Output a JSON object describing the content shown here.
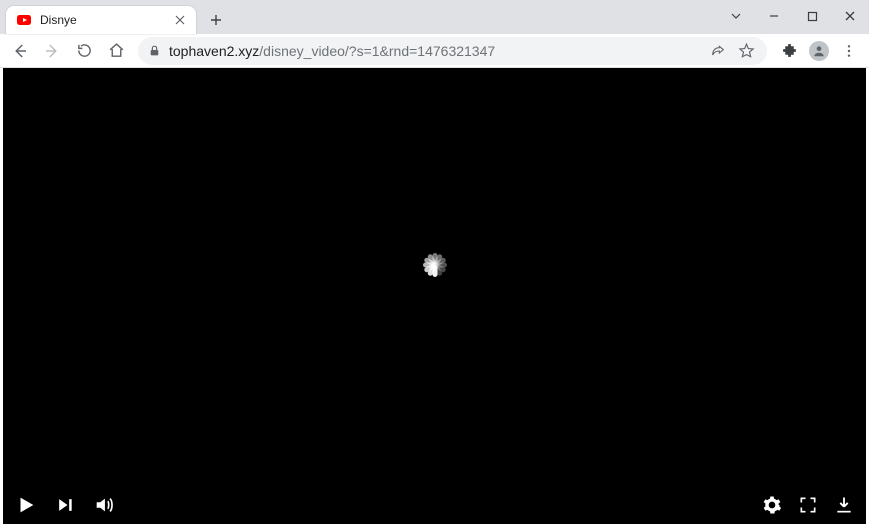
{
  "window": {
    "controls": {
      "minimize": "minimize",
      "maximize": "maximize",
      "close": "close",
      "dropdown": "dropdown"
    }
  },
  "tab": {
    "title": "Disnye",
    "favicon": "youtube-icon"
  },
  "toolbar": {
    "back": "back",
    "forward": "forward",
    "reload": "reload",
    "home": "home",
    "url_domain": "tophaven2.xyz",
    "url_path": "/disney_video/?s=1&rnd=1476321347",
    "share": "share",
    "star": "bookmark",
    "extensions": "extensions",
    "profile": "profile",
    "menu": "menu"
  },
  "player": {
    "play": "play",
    "next": "next",
    "volume": "volume",
    "settings": "settings",
    "fullscreen": "fullscreen",
    "download": "download",
    "loading": "loading"
  }
}
